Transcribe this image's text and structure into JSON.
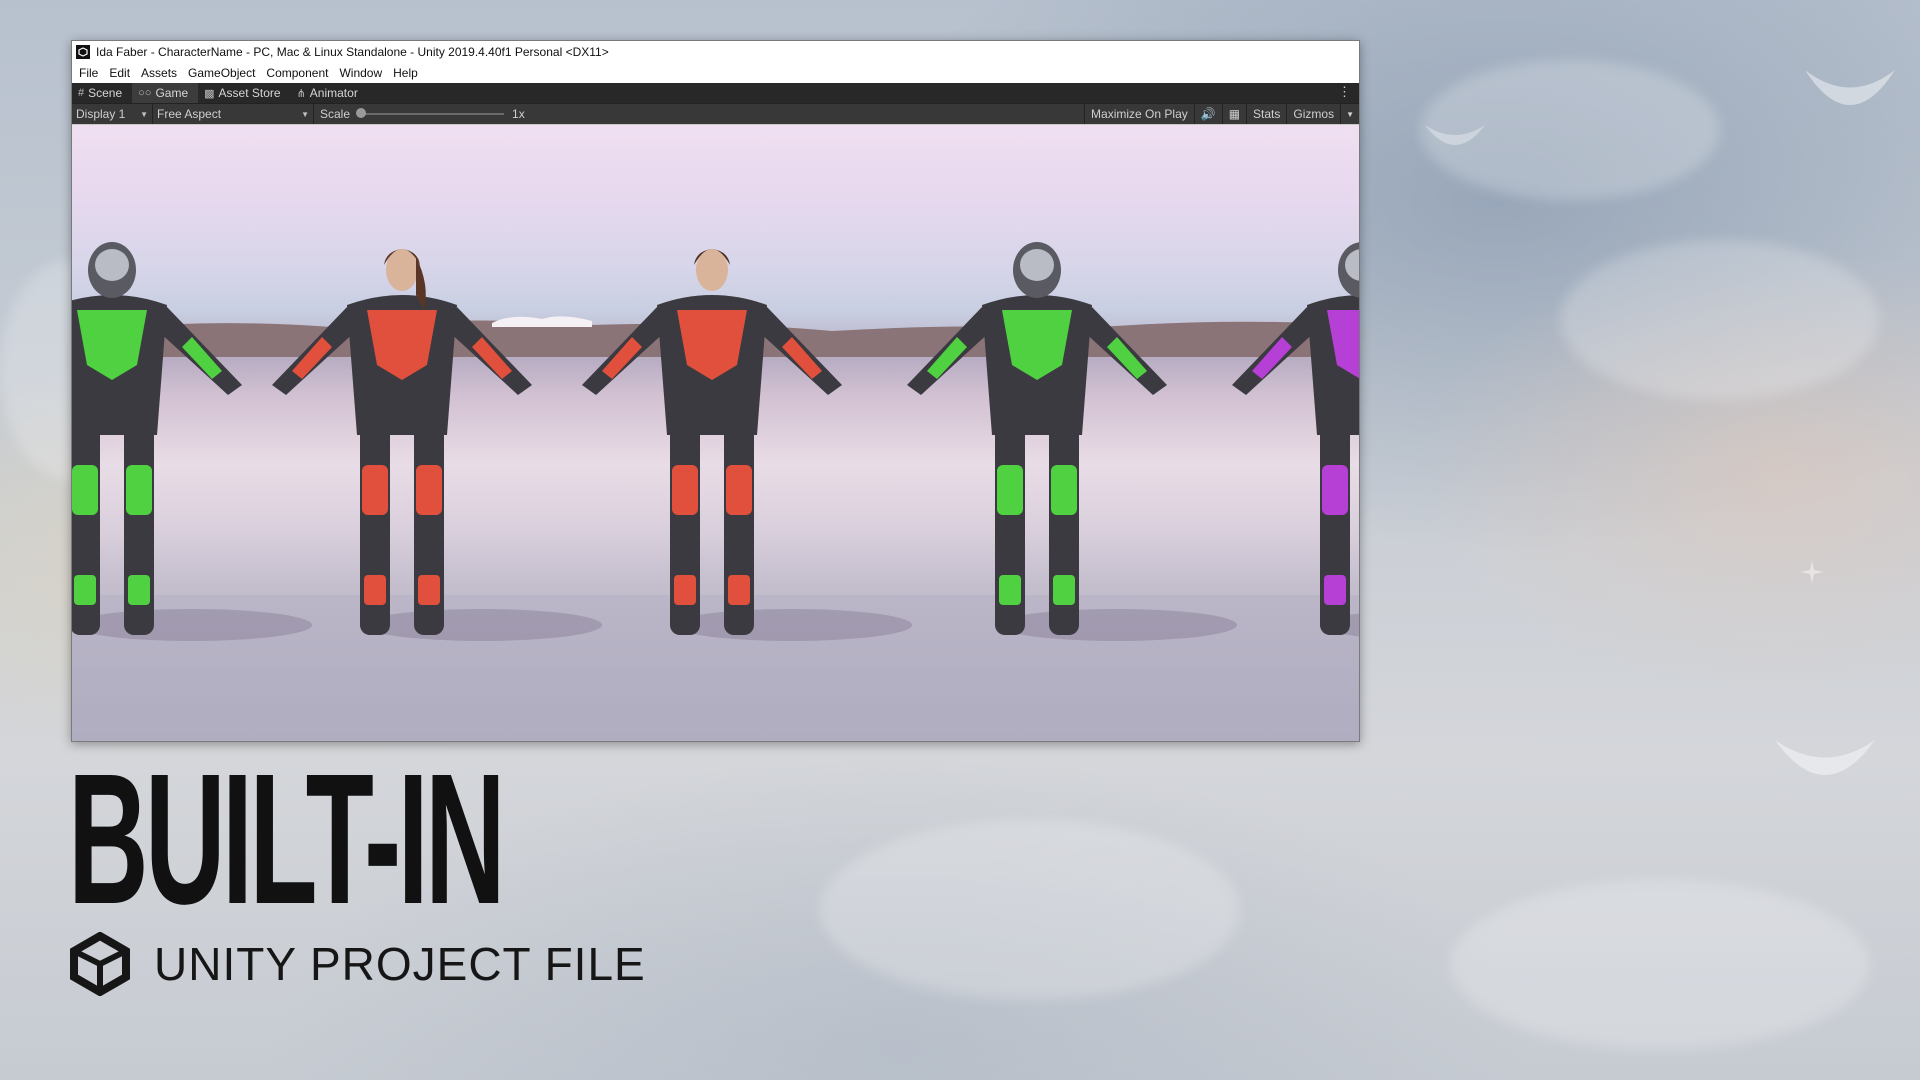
{
  "window": {
    "title": "Ida Faber - CharacterName - PC, Mac & Linux Standalone - Unity 2019.4.40f1 Personal <DX11>",
    "menu": [
      "File",
      "Edit",
      "Assets",
      "GameObject",
      "Component",
      "Window",
      "Help"
    ],
    "tabs": [
      {
        "label": "Scene",
        "icon": "grid-icon"
      },
      {
        "label": "Game",
        "icon": "gamepad-icon"
      },
      {
        "label": "Asset Store",
        "icon": "bag-icon"
      },
      {
        "label": "Animator",
        "icon": "animator-icon"
      }
    ],
    "toolbar": {
      "display": "Display 1",
      "aspect": "Free Aspect",
      "scale_label": "Scale",
      "scale_value": "1x",
      "maximize": "Maximize On Play",
      "stats": "Stats",
      "gizmos": "Gizmos"
    }
  },
  "viewport": {
    "characters": [
      {
        "accent": "#4fd142",
        "type": "helmet"
      },
      {
        "accent": "#e0503c",
        "type": "female"
      },
      {
        "accent": "#e0503c",
        "type": "male"
      },
      {
        "accent": "#4fd142",
        "type": "helmet"
      },
      {
        "accent": "#b63fd6",
        "type": "helmet"
      }
    ]
  },
  "promo": {
    "headline": "BUILT-IN",
    "subline": "UNITY PROJECT FILE"
  }
}
